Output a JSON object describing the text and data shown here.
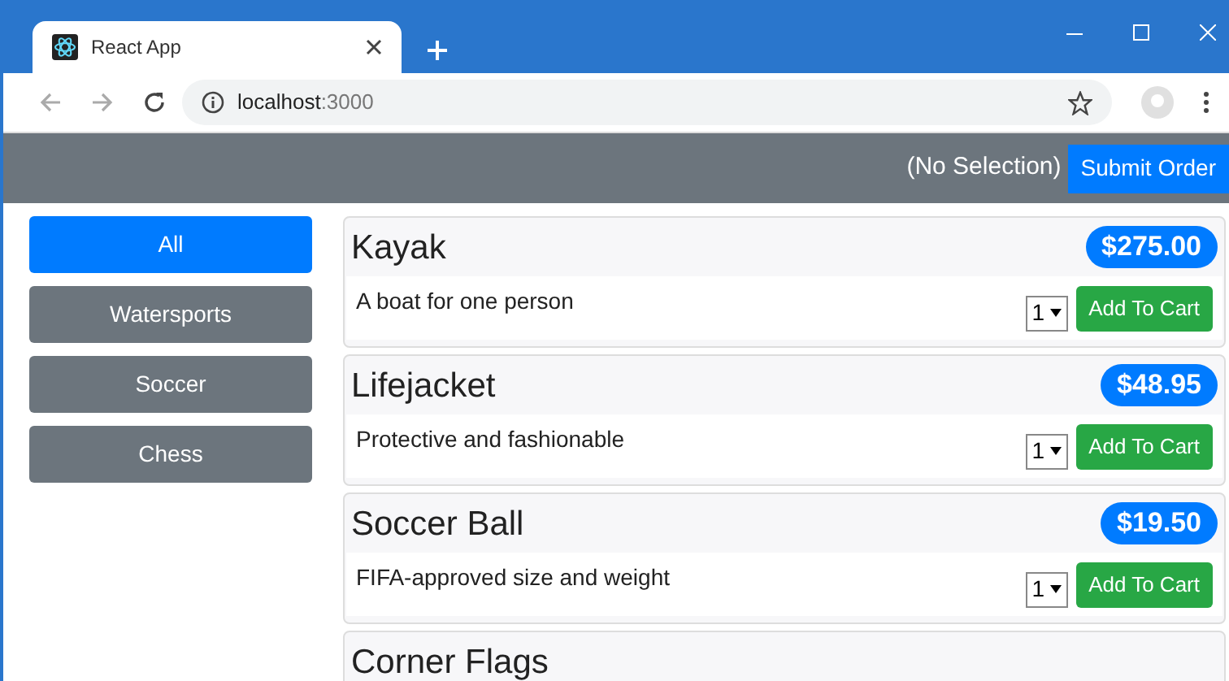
{
  "browser": {
    "tab_title": "React App",
    "address_host": "localhost",
    "address_port": ":3000"
  },
  "header": {
    "selection": "(No Selection)",
    "submit_button": "Submit Order"
  },
  "categories": [
    {
      "label": "All",
      "selected": true
    },
    {
      "label": "Watersports",
      "selected": false
    },
    {
      "label": "Soccer",
      "selected": false
    },
    {
      "label": "Chess",
      "selected": false
    }
  ],
  "products": [
    {
      "name": "Kayak",
      "price": "$275.00",
      "description": "A boat for one person",
      "quantity": "1",
      "button": "Add To Cart"
    },
    {
      "name": "Lifejacket",
      "price": "$48.95",
      "description": "Protective and fashionable",
      "quantity": "1",
      "button": "Add To Cart"
    },
    {
      "name": "Soccer Ball",
      "price": "$19.50",
      "description": "FIFA-approved size and weight",
      "quantity": "1",
      "button": "Add To Cart"
    },
    {
      "name": "Corner Flags"
    }
  ]
}
